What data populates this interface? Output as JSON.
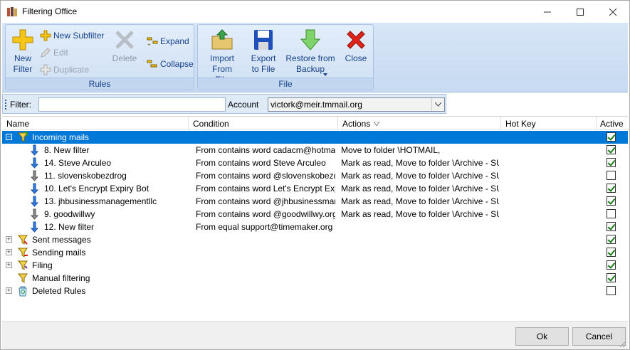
{
  "window": {
    "title": "Filtering Office"
  },
  "ribbon": {
    "rules": {
      "label": "Rules",
      "new_filter": "New Filter",
      "new_subfilter": "New Subfilter",
      "edit": "Edit",
      "duplicate": "Duplicate",
      "delete": "Delete",
      "expand": "Expand",
      "collapse": "Collapse"
    },
    "file": {
      "label": "File",
      "import": "Import From File",
      "export": "Export to File",
      "restore": "Restore from Backup",
      "close": "Close"
    }
  },
  "filterbar": {
    "filter_label": "Filter:",
    "filter_value": "",
    "account_label": "Account",
    "account_value": "victork@meir.tmmail.org"
  },
  "grid": {
    "columns": {
      "name": "Name",
      "condition": "Condition",
      "actions": "Actions",
      "hotkey": "Hot Key",
      "active": "Active"
    },
    "rows": [
      {
        "name": "Incoming mails",
        "condition": "",
        "actions": "",
        "active": true,
        "level": 0,
        "expander": "−",
        "icon": "incoming-folder-icon",
        "selected": true
      },
      {
        "name": "8. New filter",
        "condition": "From contains word cadacm@hotmail....",
        "actions": "Move to folder \\HOTMAIL,",
        "active": true,
        "level": 1,
        "icon": "down-arrow-blue-icon"
      },
      {
        "name": "14. Steve Arculeo",
        "condition": "From contains word Steve Arculeo",
        "actions": "Mark as read, Move to folder \\Archive - SU...",
        "active": true,
        "level": 1,
        "icon": "down-arrow-blue-icon"
      },
      {
        "name": "11. slovenskobezdrog",
        "condition": "From contains word @slovenskobezdr...",
        "actions": "Mark as read, Move to folder \\Archive - SU...",
        "active": false,
        "level": 1,
        "icon": "down-arrow-gray-icon"
      },
      {
        "name": "10. Let's Encrypt Expiry Bot",
        "condition": "From contains word Let's Encrypt Expi...",
        "actions": "Mark as read, Move to folder \\Archive - SU...",
        "active": true,
        "level": 1,
        "icon": "down-arrow-blue-icon"
      },
      {
        "name": "13. jhbusinessmanagementllc",
        "condition": "From contains word @jhbusinessmana...",
        "actions": "Mark as read, Move to folder \\Archive - SU...",
        "active": true,
        "level": 1,
        "icon": "down-arrow-blue-icon"
      },
      {
        "name": "9. goodwillwy",
        "condition": "From contains word @goodwillwy.org",
        "actions": "Mark as read, Move to folder \\Archive - SU...",
        "active": false,
        "level": 1,
        "icon": "down-arrow-gray-icon"
      },
      {
        "name": "12. New filter",
        "condition": "From equal support@timemaker.org",
        "actions": "",
        "active": true,
        "level": 1,
        "icon": "down-arrow-blue-icon"
      },
      {
        "name": "Sent messages",
        "condition": "",
        "actions": "",
        "active": true,
        "level": 0,
        "expander": "+",
        "icon": "sent-folder-icon"
      },
      {
        "name": "Sending mails",
        "condition": "",
        "actions": "",
        "active": true,
        "level": 0,
        "expander": "+",
        "icon": "sending-folder-icon"
      },
      {
        "name": "Filing",
        "condition": "",
        "actions": "",
        "active": true,
        "level": 0,
        "expander": "+",
        "icon": "filing-folder-icon"
      },
      {
        "name": "Manual filtering",
        "condition": "",
        "actions": "",
        "active": true,
        "level": 0,
        "icon": "funnel-icon"
      },
      {
        "name": "Deleted Rules",
        "condition": "",
        "actions": "",
        "active": false,
        "level": 0,
        "expander": "+",
        "icon": "recycle-bin-icon"
      }
    ]
  },
  "footer": {
    "ok": "Ok",
    "cancel": "Cancel"
  }
}
